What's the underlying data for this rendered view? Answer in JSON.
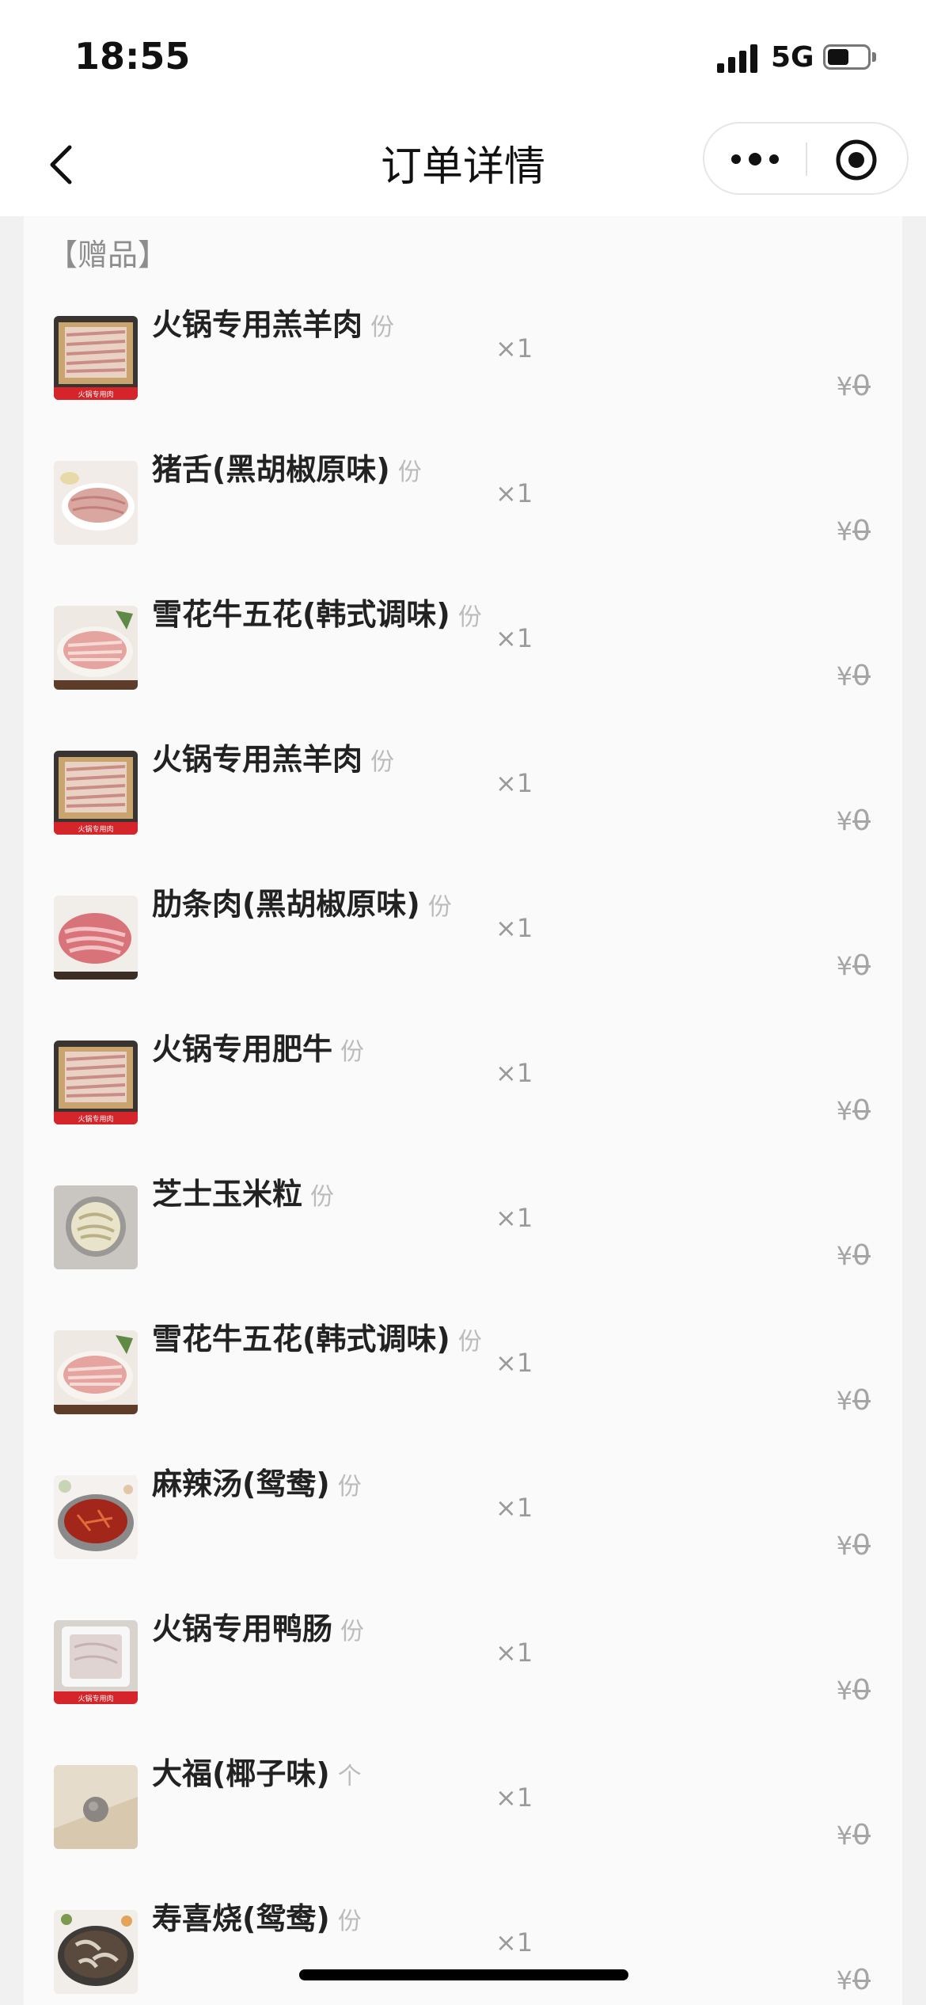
{
  "status_bar": {
    "time": "18:55",
    "network": "5G",
    "battery_level": 0.55
  },
  "nav": {
    "title": "订单详情",
    "back_icon": "chevron-left-icon",
    "more_icon": "more-dots-icon",
    "target_icon": "target-icon"
  },
  "section": {
    "label": "【赠品】"
  },
  "items": [
    {
      "name": "火锅专用羔羊肉",
      "unit": "份",
      "qty": "×1",
      "currency": "¥",
      "price": "0",
      "thumb": "lamb"
    },
    {
      "name": "猪舌(黑胡椒原味)",
      "unit": "份",
      "qty": "×1",
      "currency": "¥",
      "price": "0",
      "thumb": "tongue"
    },
    {
      "name": "雪花牛五花(韩式调味)",
      "unit": "份",
      "qty": "×1",
      "currency": "¥",
      "price": "0",
      "thumb": "beef"
    },
    {
      "name": "火锅专用羔羊肉",
      "unit": "份",
      "qty": "×1",
      "currency": "¥",
      "price": "0",
      "thumb": "lamb"
    },
    {
      "name": "肋条肉(黑胡椒原味)",
      "unit": "份",
      "qty": "×1",
      "currency": "¥",
      "price": "0",
      "thumb": "rib"
    },
    {
      "name": "火锅专用肥牛",
      "unit": "份",
      "qty": "×1",
      "currency": "¥",
      "price": "0",
      "thumb": "lamb"
    },
    {
      "name": "芝士玉米粒",
      "unit": "份",
      "qty": "×1",
      "currency": "¥",
      "price": "0",
      "thumb": "corn"
    },
    {
      "name": "雪花牛五花(韩式调味)",
      "unit": "份",
      "qty": "×1",
      "currency": "¥",
      "price": "0",
      "thumb": "beef"
    },
    {
      "name": "麻辣汤(鸳鸯)",
      "unit": "份",
      "qty": "×1",
      "currency": "¥",
      "price": "0",
      "thumb": "hotpot"
    },
    {
      "name": "火锅专用鸭肠",
      "unit": "份",
      "qty": "×1",
      "currency": "¥",
      "price": "0",
      "thumb": "duck"
    },
    {
      "name": "大福(椰子味)",
      "unit": "个",
      "qty": "×1",
      "currency": "¥",
      "price": "0",
      "thumb": "daifuku"
    },
    {
      "name": "寿喜烧(鸳鸯)",
      "unit": "份",
      "qty": "×1",
      "currency": "¥",
      "price": "0",
      "thumb": "sukiyaki"
    }
  ],
  "thumb_banner_text": "火锅专用肉"
}
